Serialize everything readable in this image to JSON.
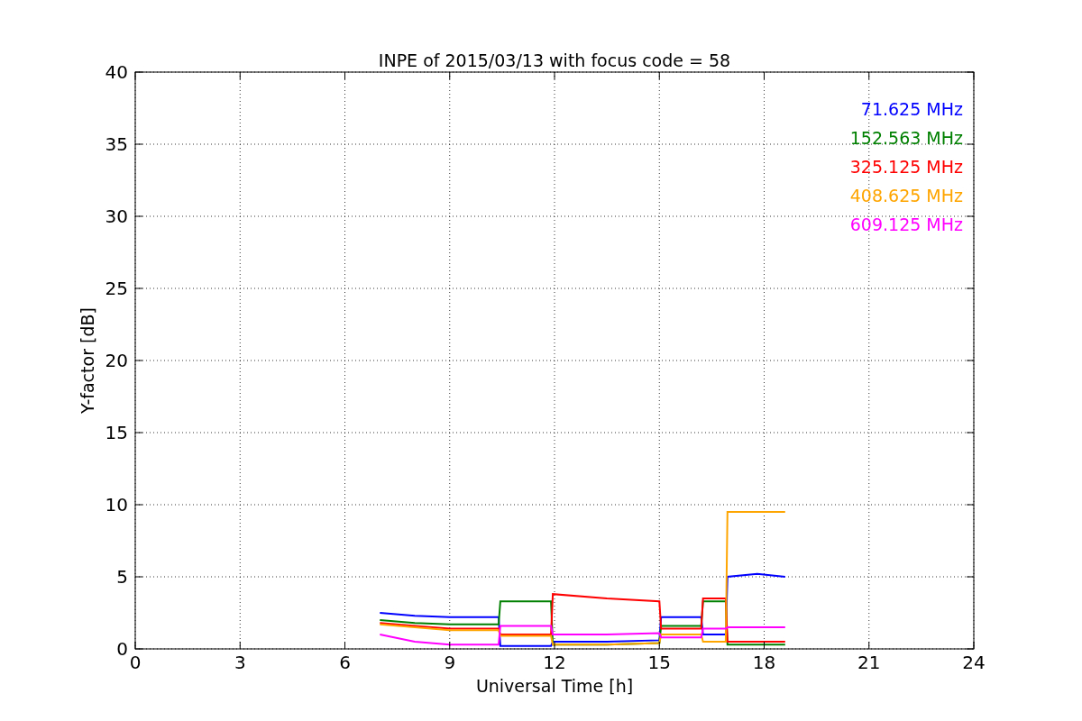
{
  "chart_data": {
    "type": "line",
    "title": "INPE of 2015/03/13 with focus code = 58",
    "xlabel": "Universal Time [h]",
    "ylabel": "Y-factor [dB]",
    "x": [
      7,
      8,
      9,
      10.4,
      10.45,
      11.9,
      11.95,
      13.5,
      15,
      15.05,
      16.2,
      16.25,
      16.9,
      16.95,
      17.8,
      18.6
    ],
    "series": [
      {
        "name": "71.625 MHz",
        "color": "#0000ff",
        "values": [
          2.5,
          2.3,
          2.2,
          2.2,
          0.2,
          0.2,
          0.5,
          0.5,
          0.6,
          2.2,
          2.2,
          1.0,
          1.0,
          5.0,
          5.2,
          5.0
        ]
      },
      {
        "name": "152.563 MHz",
        "color": "#008000",
        "values": [
          2.0,
          1.8,
          1.7,
          1.7,
          3.3,
          3.3,
          0.3,
          0.3,
          0.4,
          1.6,
          1.6,
          3.3,
          3.3,
          0.3,
          0.3,
          0.3
        ]
      },
      {
        "name": "325.125 MHz",
        "color": "#ff0000",
        "values": [
          1.8,
          1.6,
          1.4,
          1.4,
          1.0,
          1.0,
          3.8,
          3.5,
          3.3,
          1.4,
          1.4,
          3.5,
          3.5,
          0.5,
          0.5,
          0.5
        ]
      },
      {
        "name": "408.625 MHz",
        "color": "#ffa500",
        "values": [
          1.7,
          1.5,
          1.3,
          1.3,
          0.9,
          0.9,
          0.3,
          0.3,
          0.4,
          1.0,
          1.0,
          0.5,
          0.5,
          9.5,
          9.5,
          9.5
        ]
      },
      {
        "name": "609.125 MHz",
        "color": "#ff00ff",
        "values": [
          1.0,
          0.5,
          0.3,
          0.3,
          1.6,
          1.6,
          1.0,
          1.0,
          1.1,
          0.8,
          0.8,
          1.4,
          1.4,
          1.5,
          1.5,
          1.5
        ]
      }
    ],
    "grid": true,
    "xlim": [
      0,
      24
    ],
    "ylim": [
      0,
      40
    ],
    "xticks": [
      0,
      3,
      6,
      9,
      12,
      15,
      18,
      21,
      24
    ],
    "yticks": [
      0,
      5,
      10,
      15,
      20,
      25,
      30,
      35,
      40
    ]
  }
}
